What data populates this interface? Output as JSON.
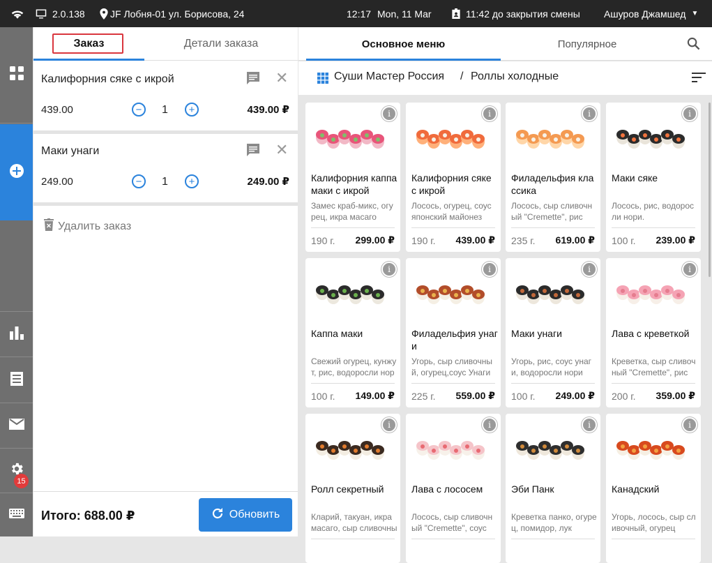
{
  "topbar": {
    "version": "2.0.138",
    "location": "JF Лобня-01 ул. Борисова, 24",
    "time": "12:17",
    "date": "Mon, 11 Mar",
    "shift": "11:42 до закрытия смены",
    "user": "Ашуров Джамшед"
  },
  "sidebar": {
    "notifications_badge": "15"
  },
  "order": {
    "tab_order": "Заказ",
    "tab_details": "Детали заказа",
    "items": [
      {
        "name": "Калифорния сяке с икрой",
        "price": "439.00",
        "qty": "1",
        "total": "439.00 ₽"
      },
      {
        "name": "Маки унаги",
        "price": "249.00",
        "qty": "1",
        "total": "249.00 ₽"
      }
    ],
    "delete_label": "Удалить заказ",
    "total_label": "Итого: 688.00 ₽",
    "refresh_label": "Обновить"
  },
  "menu": {
    "tab_main": "Основное меню",
    "tab_popular": "Популярное",
    "breadcrumb_root": "Суши Мастер Россия",
    "breadcrumb_sep": "/",
    "breadcrumb_current": "Роллы холодные",
    "products": [
      {
        "title": "Калифорния каппа маки с икрой",
        "desc": "Замес краб-микс, огурец, икра масаго",
        "weight": "190 г.",
        "price": "299.00 ₽"
      },
      {
        "title": "Калифорния сяке с икрой",
        "desc": "Лосось, огурец, соус японский майонез",
        "weight": "190 г.",
        "price": "439.00 ₽"
      },
      {
        "title": "Филадельфия классика",
        "desc": "Лосось, сыр сливочный \"Cremette\", рис",
        "weight": "235 г.",
        "price": "619.00 ₽"
      },
      {
        "title": "Маки сяке",
        "desc": "Лосось, рис, водоросли нори.",
        "weight": "100 г.",
        "price": "239.00 ₽"
      },
      {
        "title": "Каппа маки",
        "desc": "Свежий огурец, кунжут, рис, водоросли нори",
        "weight": "100 г.",
        "price": "149.00 ₽"
      },
      {
        "title": "Филадельфия унаги",
        "desc": "Угорь, сыр сливочный, огурец,соус Унаги",
        "weight": "225 г.",
        "price": "559.00 ₽"
      },
      {
        "title": "Маки унаги",
        "desc": "Угорь, рис, соус унаги, водоросли нори",
        "weight": "100 г.",
        "price": "249.00 ₽"
      },
      {
        "title": "Лава с креветкой",
        "desc": "Креветка, сыр сливочный \"Cremette\", рис",
        "weight": "200 г.",
        "price": "359.00 ₽"
      },
      {
        "title": "Ролл секретный",
        "desc": "Кларий, такуан, икра масаго, сыр сливочный",
        "weight": "",
        "price": ""
      },
      {
        "title": "Лава с лососем",
        "desc": "Лосось, сыр сливочный \"Cremette\", соус",
        "weight": "",
        "price": ""
      },
      {
        "title": "Эби Панк",
        "desc": "Креветка панко, огурец, помидор, лук",
        "weight": "",
        "price": ""
      },
      {
        "title": "Канадский",
        "desc": "Угорь, лосось, сыр сливочный, огурец",
        "weight": "",
        "price": ""
      }
    ]
  }
}
